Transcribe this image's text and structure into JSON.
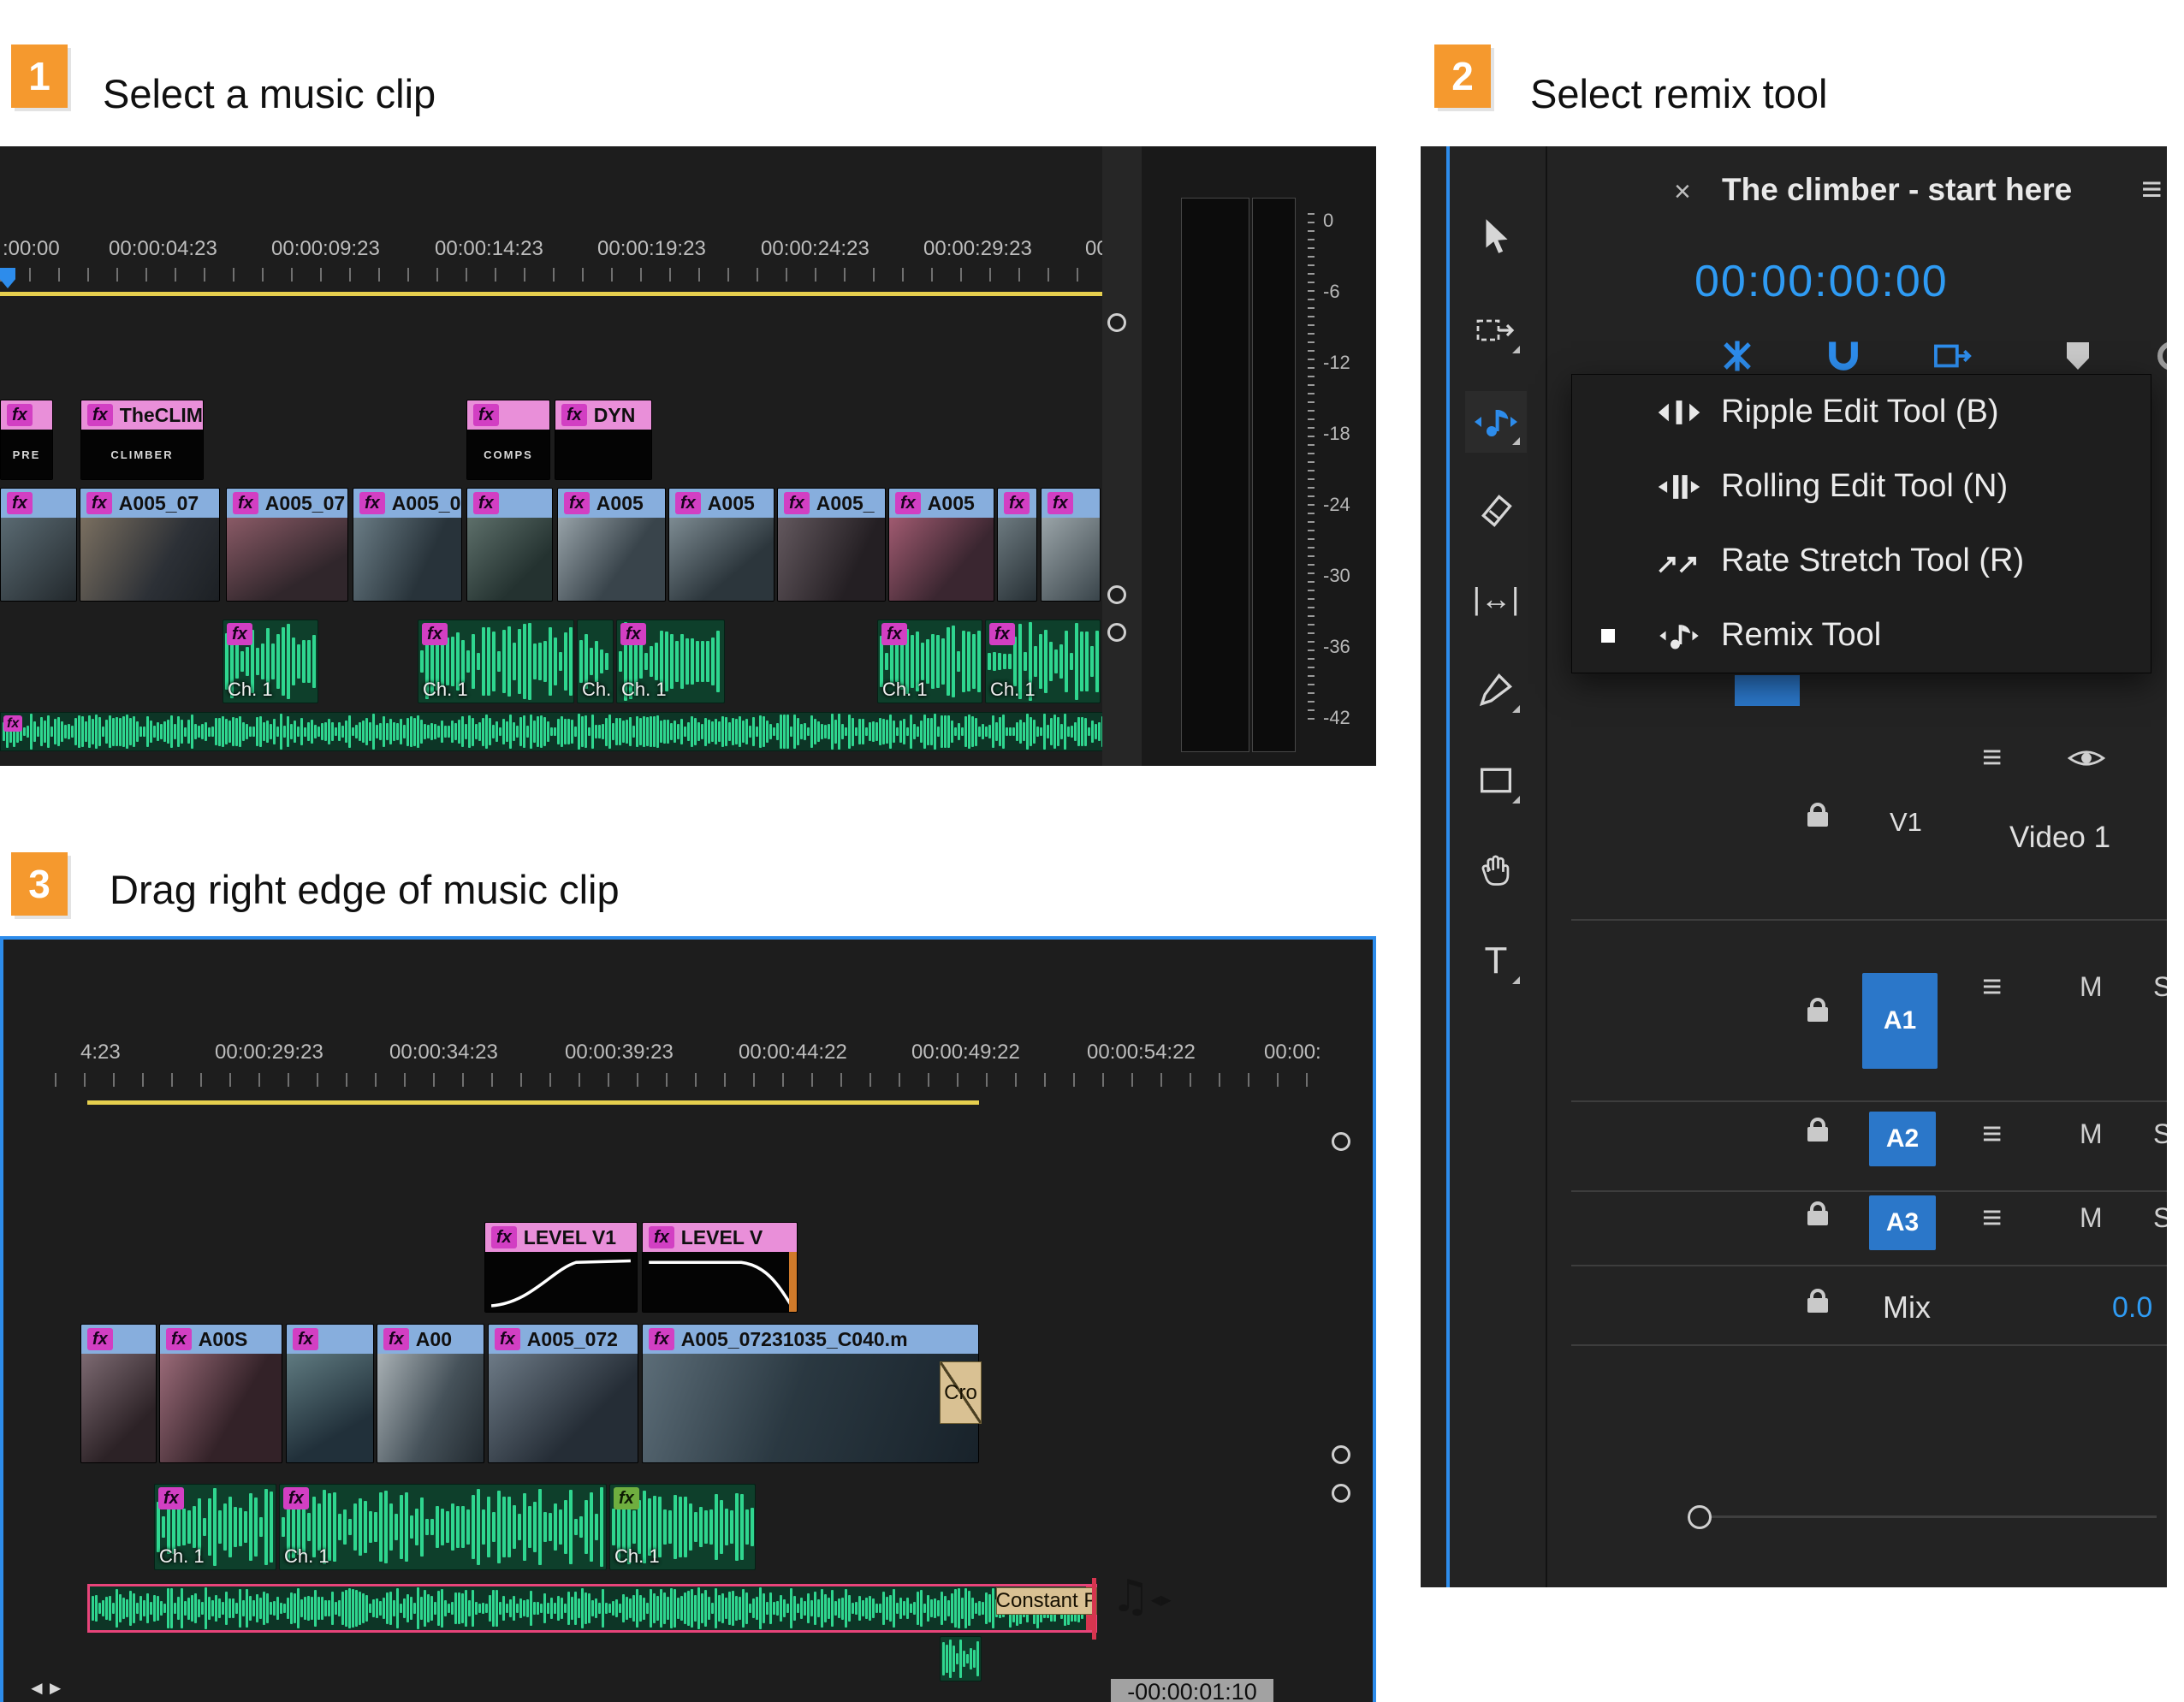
{
  "misc": {
    "fx": "fx"
  },
  "steps": {
    "step1": {
      "number": "1",
      "title": "Select a music clip"
    },
    "step2": {
      "number": "2",
      "title": "Select remix tool"
    },
    "step3": {
      "number": "3",
      "title": "Drag right edge of music clip"
    }
  },
  "colors": {
    "accent_blue": "#2d8ceb",
    "badge_orange": "#f5992e",
    "wave_green": "#2fd68f",
    "selection_red": "#e8447a"
  },
  "panel1": {
    "ruler": [
      ":00:00",
      "00:00:04:23",
      "00:00:09:23",
      "00:00:14:23",
      "00:00:19:23",
      "00:00:24:23",
      "00:00:29:23",
      "00:0"
    ],
    "meter": [
      "0",
      "-6",
      "-12",
      "-18",
      "-24",
      "-30",
      "-36",
      "-42"
    ],
    "v2": [
      {
        "label": "",
        "body": "PRE"
      },
      {
        "label": "TheCLIM",
        "body": "CLIMBER"
      },
      {
        "label": "",
        "body": "COMPS"
      },
      {
        "label": "DYN",
        "body": ""
      }
    ],
    "v1": [
      "",
      "A005_07",
      "A005_07",
      "A005_0",
      "",
      "A005",
      "A005",
      "A005_",
      "A005",
      "",
      ""
    ],
    "audio": [
      "Ch. 1",
      "Ch. 1",
      "Ch. 1",
      "Ch. 1",
      "Ch. 1",
      "Ch. 1"
    ]
  },
  "panel2": {
    "tab": {
      "close": "×",
      "title": "The climber - start here",
      "menu_icon": "≡"
    },
    "timecode": "00:00:00:00",
    "menu": [
      "Ripple Edit Tool (B)",
      "Rolling Edit Tool (N)",
      "Rate Stretch Tool (R)",
      "Remix Tool"
    ],
    "tracks": {
      "v1": "V1",
      "video1": "Video 1",
      "a1": "A1",
      "a2": "A2",
      "a3": "A3",
      "mix": "Mix",
      "mix_value": "0.0",
      "mute": "M",
      "solo": "S",
      "settings_icon": "≡"
    },
    "type_tool": "T",
    "slip_tool": "|↔|"
  },
  "panel3": {
    "ruler": [
      "4:23",
      "00:00:29:23",
      "00:00:34:23",
      "00:00:39:23",
      "00:00:44:22",
      "00:00:49:22",
      "00:00:54:22",
      "00:00:"
    ],
    "levels": [
      "LEVEL V1",
      "LEVEL V"
    ],
    "v1": [
      "",
      "A00S",
      "",
      "A00",
      "A005_072",
      "A005_07231035_C040.m"
    ],
    "audio": [
      "Ch. 1",
      "Ch. 1",
      "Ch. 1"
    ],
    "crossfade": "Cro",
    "transition": "Constant P",
    "tooltip": "-00:00:01:10",
    "trim_icon": "◄►"
  }
}
